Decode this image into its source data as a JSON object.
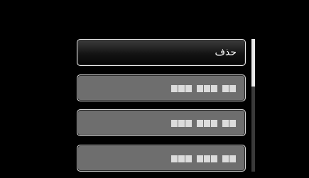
{
  "menu": {
    "items": [
      {
        "label": "حذف",
        "selected": true
      },
      {
        "label": null,
        "selected": false,
        "redacted_groups": [
          3,
          3,
          2
        ]
      },
      {
        "label": null,
        "selected": false,
        "redacted_groups": [
          3,
          3,
          2
        ]
      },
      {
        "label": null,
        "selected": false,
        "redacted_groups": [
          3,
          3,
          2
        ]
      }
    ]
  },
  "scrollbar": {
    "visible_fraction": 0.36,
    "scroll_position": 0
  },
  "colors": {
    "background": "#000000",
    "item_fill": "#6e6e6e",
    "item_border": "#d6d6d6",
    "selected_fill": "#141414",
    "text": "#ffffff",
    "scroll_track": "#3a3a3a",
    "scroll_thumb": "#e8e8e8"
  }
}
